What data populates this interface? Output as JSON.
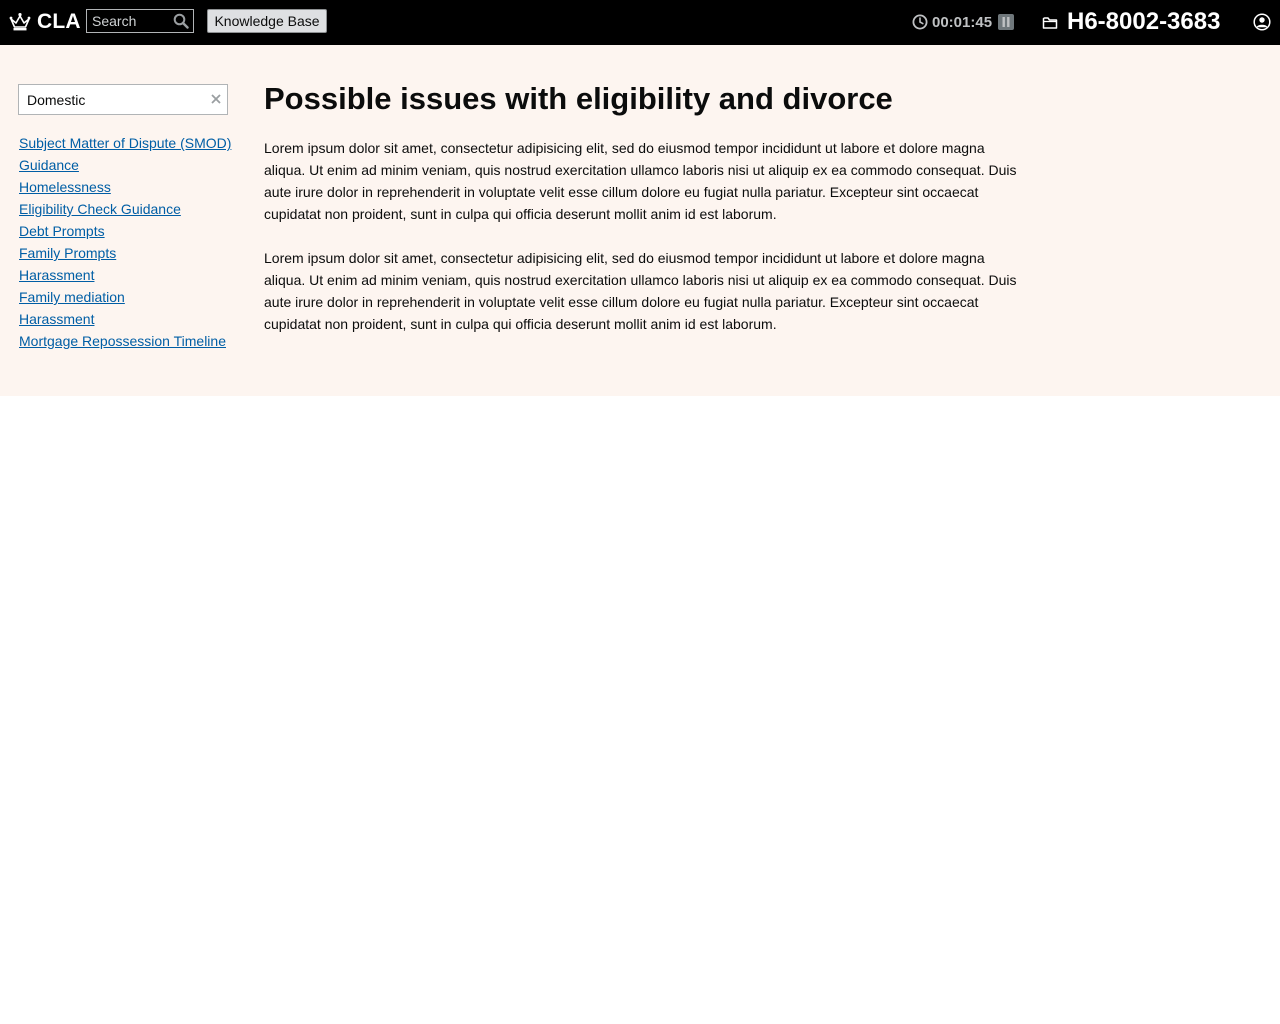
{
  "header": {
    "brand": "CLA",
    "search": {
      "placeholder": "Search",
      "value": ""
    },
    "knowledge_base_label": "Knowledge Base",
    "timer": "00:01:45",
    "case_reference": "H6-8002-3683"
  },
  "sidebar": {
    "filter": {
      "value": "Domestic"
    },
    "links": [
      {
        "label": "Subject Matter of Dispute (SMOD)"
      },
      {
        "label": "Guidance"
      },
      {
        "label": "Homelessness"
      },
      {
        "label": "Eligibility Check Guidance"
      },
      {
        "label": "Debt Prompts"
      },
      {
        "label": "Family Prompts"
      },
      {
        "label": "Harassment"
      },
      {
        "label": "Family mediation"
      },
      {
        "label": "Harassment"
      },
      {
        "label": "Mortgage Repossession Timeline"
      }
    ]
  },
  "article": {
    "title": "Possible issues with eligibility and divorce",
    "paragraphs": [
      "Lorem ipsum dolor sit amet, consectetur adipisicing elit, sed do eiusmod tempor incididunt ut labore et dolore magna aliqua. Ut enim ad minim veniam, quis nostrud exercitation ullamco laboris nisi ut aliquip ex ea commodo consequat. Duis aute irure dolor in reprehenderit in voluptate velit esse cillum dolore eu fugiat nulla pariatur. Excepteur sint occaecat cupidatat non proident, sunt in culpa qui officia deserunt mollit anim id est laborum.",
      "Lorem ipsum dolor sit amet, consectetur adipisicing elit, sed do eiusmod tempor incididunt ut labore et dolore magna aliqua. Ut enim ad minim veniam, quis nostrud exercitation ullamco laboris nisi ut aliquip ex ea commodo consequat. Duis aute irure dolor in reprehenderit in voluptate velit esse cillum dolore eu fugiat nulla pariatur. Excepteur sint occaecat cupidatat non proident, sunt in culpa qui officia deserunt mollit anim id est laborum."
    ]
  },
  "icons": {
    "brand": "crown-icon",
    "search": "search-icon",
    "timer": "clock-icon",
    "pause": "pause-icon",
    "case": "folder-icon",
    "user": "user-icon",
    "clear": "close-icon"
  },
  "colors": {
    "header_bg": "#000000",
    "main_bg": "#fdf5f0",
    "link": "#005ea5",
    "text": "#0b0c0c"
  }
}
